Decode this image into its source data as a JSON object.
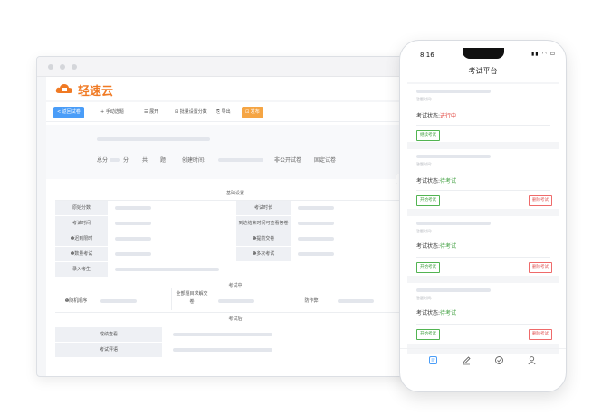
{
  "brand": {
    "name": "轻速云",
    "accent": "#f07a24",
    "primary": "#4a9df8",
    "success": "#52b452",
    "danger": "#ef6a6a"
  },
  "toolbar": {
    "back": "< 返回试卷",
    "manual": "+ 手动选题",
    "expand": "展开",
    "batch_score": "批量设置分数",
    "export": "导出",
    "publish": "发布"
  },
  "summary": {
    "total_label": "总分",
    "points_unit": "分",
    "total_count_label": "共",
    "questions_unit": "题",
    "created_label": "创建时间:",
    "nonpublic": "非公开试卷",
    "fixed": "固定试卷"
  },
  "table": {
    "section_basic": "基础设置",
    "original_score": "原始分数",
    "exam_time": "考试时间",
    "time_limit": "❶迟到限时",
    "scoring": "❶数量考试",
    "enter_examinees": "录入考生",
    "exam_duration": "考试时长",
    "after_end_view": "到达结束时间可查看答卷",
    "early_submit": "❶提前交卷",
    "multiple_attempts": "❶多次考试",
    "section_during": "考试中",
    "random_order": "❶随机顺序",
    "all_complete": "全部题目求解交卷",
    "cheating": "防作弊",
    "section_after": "考试后",
    "score_view": "成绩查看",
    "exam_review": "考试评语"
  },
  "phone": {
    "time": "8:16",
    "title": "考试平台",
    "cards": [
      {
        "time_label": "答题时间:",
        "status_label": "考试状态:",
        "status": "进行中",
        "status_color": "#e0403a",
        "btn1": "继续考试",
        "btn2": ""
      },
      {
        "time_label": "答题时间:",
        "status_label": "考试状态:",
        "status": "待考试",
        "status_color": "#3f9f3f",
        "btn1": "开始考试",
        "btn2": "删除考试"
      },
      {
        "time_label": "答题时间:",
        "status_label": "考试状态:",
        "status": "待考试",
        "status_color": "#3f9f3f",
        "btn1": "开始考试",
        "btn2": "删除考试"
      },
      {
        "time_label": "答题时间:",
        "status_label": "考试状态:",
        "status": "待考试",
        "status_color": "#3f9f3f",
        "btn1": "开始考试",
        "btn2": "删除考试"
      }
    ],
    "tabs": [
      "exam-icon",
      "edit-icon",
      "check-icon",
      "user-icon"
    ]
  }
}
